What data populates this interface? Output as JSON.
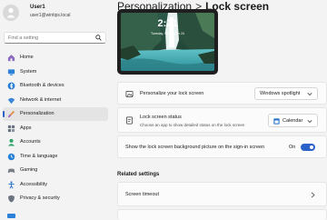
{
  "user": {
    "name": "User1",
    "email": "user1@wintips.local"
  },
  "search": {
    "placeholder": "Find a setting"
  },
  "nav": [
    {
      "label": "Home",
      "icon": "home-icon"
    },
    {
      "label": "System",
      "icon": "system-icon"
    },
    {
      "label": "Bluetooth & devices",
      "icon": "bluetooth-icon"
    },
    {
      "label": "Network & internet",
      "icon": "network-icon"
    },
    {
      "label": "Personalization",
      "icon": "brush-icon",
      "active": true
    },
    {
      "label": "Apps",
      "icon": "apps-icon"
    },
    {
      "label": "Accounts",
      "icon": "accounts-icon"
    },
    {
      "label": "Time & language",
      "icon": "time-icon"
    },
    {
      "label": "Gaming",
      "icon": "gaming-icon"
    },
    {
      "label": "Accessibility",
      "icon": "accessibility-icon"
    },
    {
      "label": "Privacy & security",
      "icon": "shield-icon"
    }
  ],
  "breadcrumb": {
    "parent": "Personalization",
    "separator": ">",
    "current": "Lock screen"
  },
  "preview": {
    "time": "2:21",
    "date": "Tuesday, September 24"
  },
  "settings": {
    "personalize": {
      "label": "Personalize your lock screen",
      "value": "Windows spotlight"
    },
    "status": {
      "label": "Lock screen status",
      "sub": "Choose an app to show detailed status on the lock screen",
      "value": "Calendar"
    },
    "signin": {
      "label": "Show the lock screen background picture on the sign-in screen",
      "state": "On"
    }
  },
  "related": {
    "title": "Related settings",
    "screen_timeout": "Screen timeout"
  },
  "colors": {
    "accent": "#2b62c9"
  }
}
